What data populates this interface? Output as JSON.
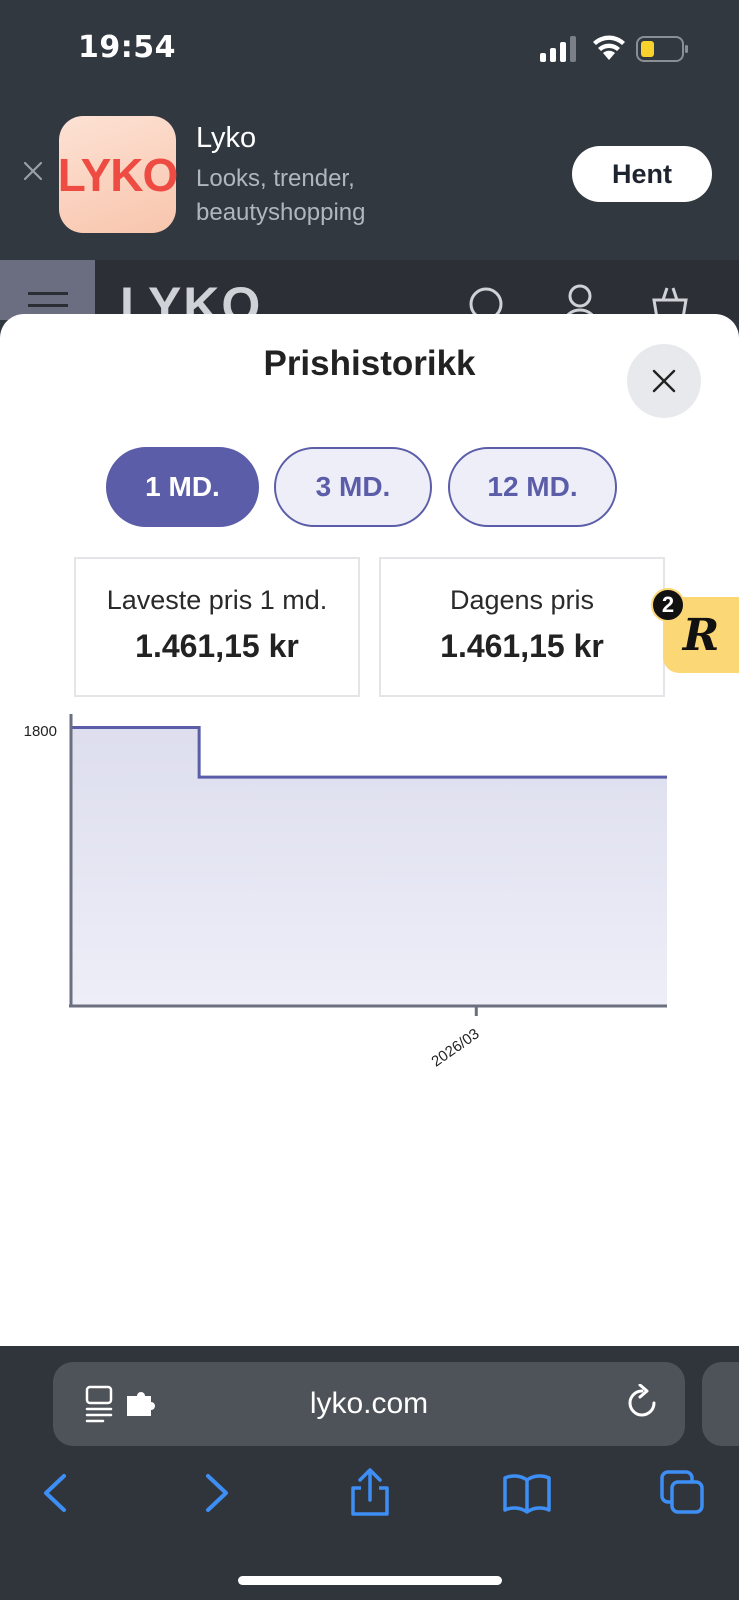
{
  "status_bar": {
    "time": "19:54"
  },
  "app_banner": {
    "icon_text": "LYKO",
    "name": "Lyko",
    "subtitle": "Looks, trender, beautyshopping",
    "get_label": "Hent"
  },
  "site_header": {
    "logo": "LYKO"
  },
  "sheet": {
    "title": "Prishistorikk",
    "tabs": [
      {
        "label": "1 MD.",
        "active": true
      },
      {
        "label": "3 MD.",
        "active": false
      },
      {
        "label": "12 MD.",
        "active": false
      }
    ],
    "lowest": {
      "label": "Laveste pris 1 md.",
      "value": "1.461,15 kr"
    },
    "today": {
      "label": "Dagens pris",
      "value": "1.461,15 kr"
    }
  },
  "reviews_badge": {
    "letter": "R",
    "count": "2"
  },
  "chart_data": {
    "type": "area",
    "step": true,
    "ylim": [
      0,
      1800
    ],
    "yticks": [
      "1800"
    ],
    "xticks": [
      "2026/03"
    ],
    "xtick_fraction": 0.68,
    "points": [
      {
        "x": 0.0,
        "y": 1778
      },
      {
        "x": 0.215,
        "y": 1778
      },
      {
        "x": 0.215,
        "y": 1461.15
      },
      {
        "x": 1.0,
        "y": 1461.15
      }
    ],
    "colors": {
      "line": "#5b5da8",
      "fill_top": "#dddeee",
      "fill_bottom": "#eeeef8",
      "axis": "#6b6f80"
    }
  },
  "browser": {
    "url": "lyko.com"
  },
  "colors": {
    "accent": "#5b5da8",
    "banner_bg": "#323840"
  }
}
